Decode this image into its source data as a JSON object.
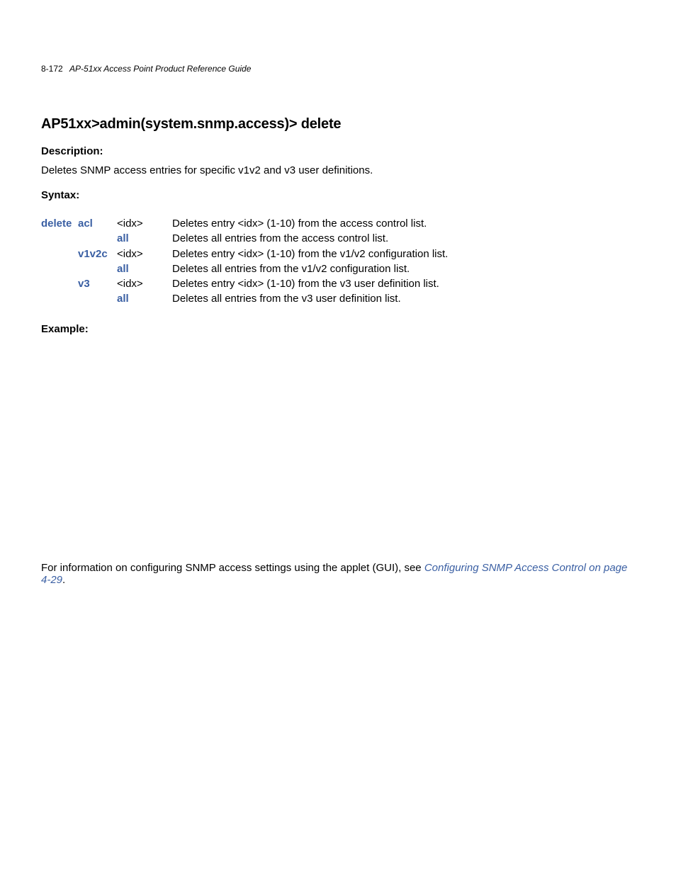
{
  "header": {
    "page_number": "8-172",
    "doc_title": "AP-51xx Access Point Product Reference Guide"
  },
  "command": {
    "heading": "AP51xx>admin(system.snmp.access)> delete"
  },
  "description": {
    "label": "Description:",
    "text": "Deletes SNMP access entries for specific v1v2 and v3 user definitions."
  },
  "syntax": {
    "label": "Syntax:",
    "cmd": "delete",
    "rows": [
      {
        "sub": "acl",
        "arg": "<idx>",
        "desc": "Deletes entry <idx> (1-10) from the access control list."
      },
      {
        "sub": "",
        "arg": "all",
        "desc": "Deletes all entries from the access control list."
      },
      {
        "sub": "v1v2c",
        "arg": "<idx>",
        "desc": "Deletes entry <idx> (1-10) from the v1/v2 configuration list."
      },
      {
        "sub": "",
        "arg": "all",
        "desc": "Deletes all entries from the v1/v2 configuration list."
      },
      {
        "sub": "v3",
        "arg": "<idx>",
        "desc": "Deletes entry <idx> (1-10) from the v3 user definition list."
      },
      {
        "sub": "",
        "arg": "all",
        "desc": "Deletes all entries from the v3 user definition list."
      }
    ]
  },
  "example": {
    "label": "Example:"
  },
  "crossref": {
    "prefix": "For information on configuring SNMP access settings using the applet (GUI), see ",
    "link": "Configuring SNMP Access Control on page 4-29",
    "suffix": "."
  }
}
